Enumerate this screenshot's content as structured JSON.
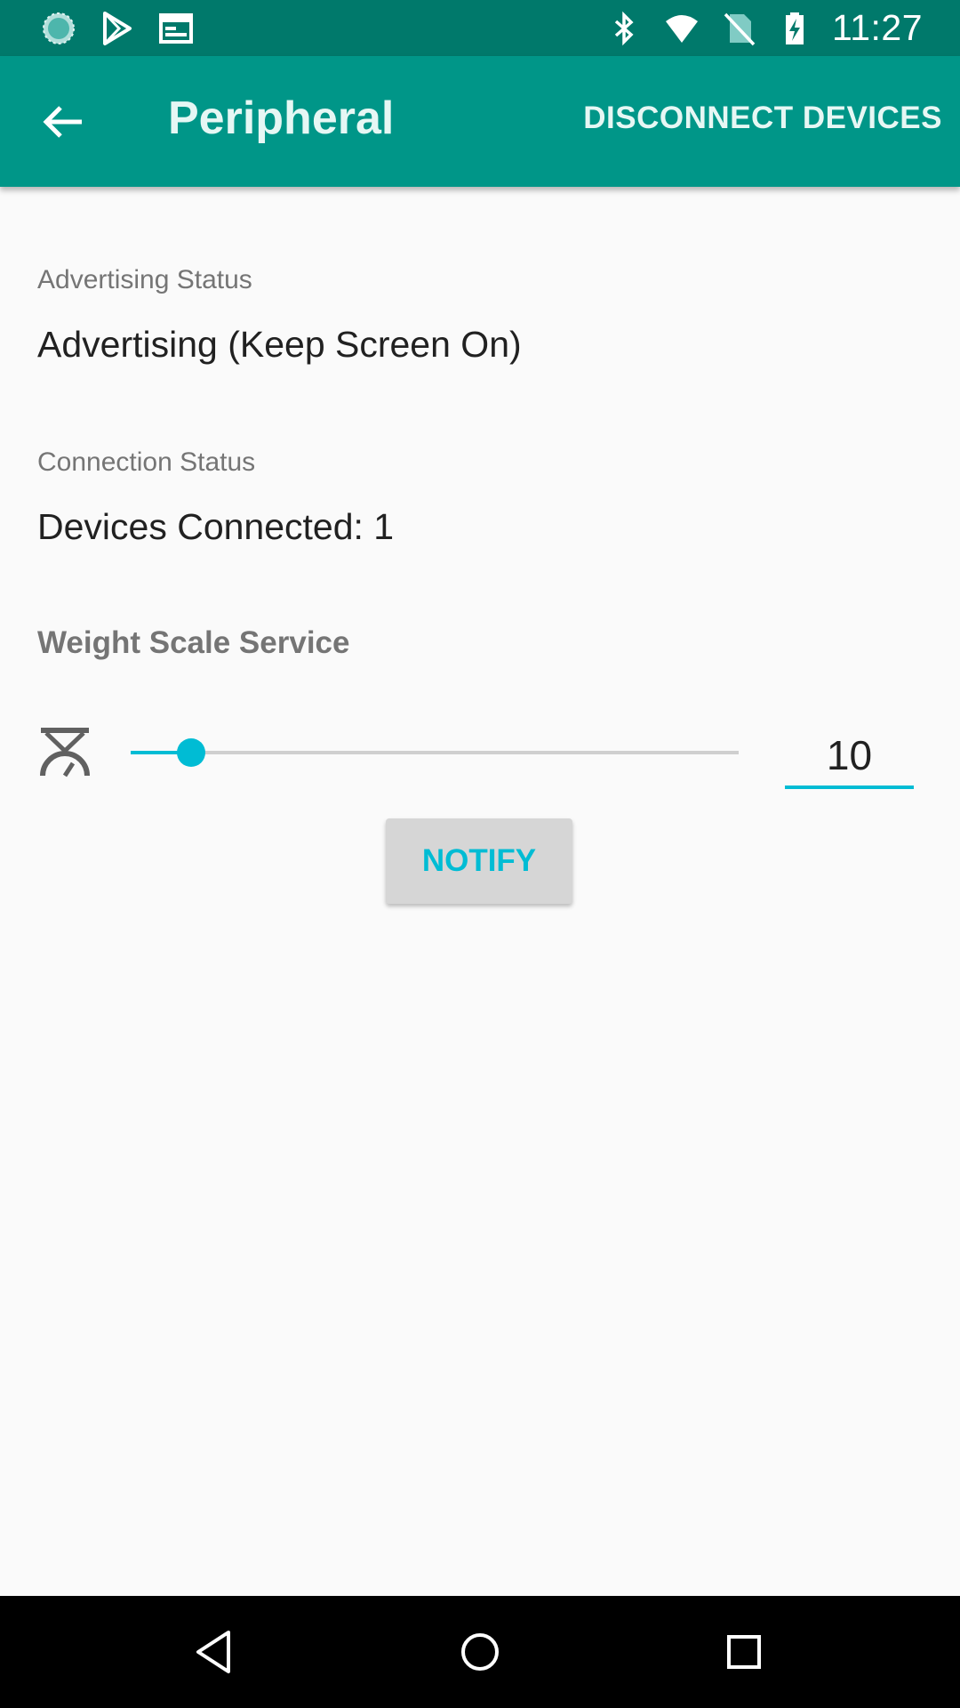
{
  "status_bar": {
    "time": "11:27",
    "left_icons": [
      "sync-icon",
      "play-store-icon",
      "calendar-icon"
    ],
    "right_icons": [
      "bluetooth-icon",
      "wifi-icon",
      "no-sim-icon",
      "battery-charging-icon"
    ]
  },
  "app_bar": {
    "title": "Peripheral",
    "back_icon": "arrow-back-icon",
    "action_label": "DISCONNECT DEVICES"
  },
  "advertising": {
    "label": "Advertising Status",
    "value": "Advertising (Keep Screen On)"
  },
  "connection": {
    "label": "Connection Status",
    "value": "Devices Connected: 1"
  },
  "service": {
    "title": "Weight Scale Service",
    "icon": "weight-scale-icon",
    "slider_fraction": 0.1,
    "value": "10",
    "notify_label": "NOTIFY"
  },
  "colors": {
    "primary": "#009688",
    "primary_dark": "#00796b",
    "accent": "#00bcd4"
  },
  "nav_bar": {
    "icons": [
      "back-triangle-icon",
      "home-circle-icon",
      "recents-square-icon"
    ]
  }
}
